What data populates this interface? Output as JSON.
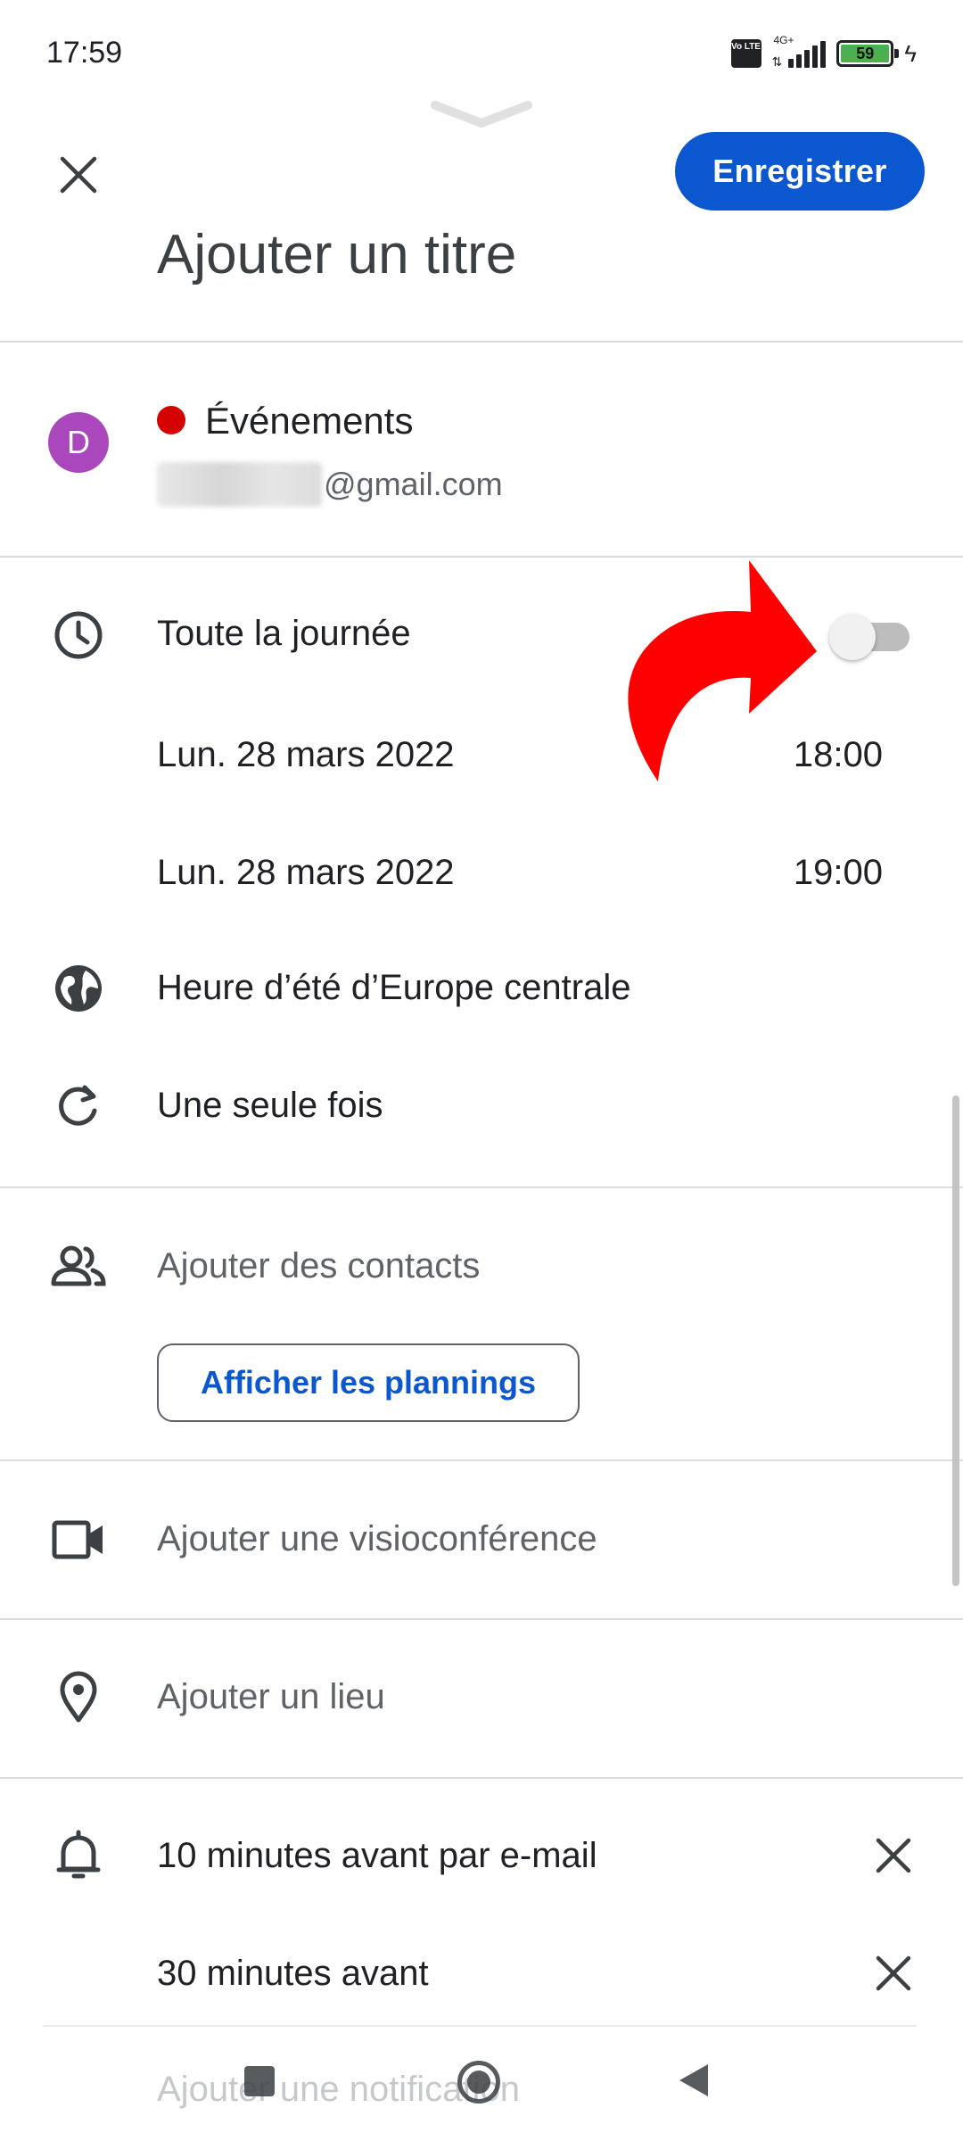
{
  "status_bar": {
    "time": "17:59",
    "volte": "Vo LTE",
    "network": "4G+",
    "battery_level": "59",
    "charging_icon": "bolt-icon"
  },
  "header": {
    "close_icon": "close-icon",
    "save_label": "Enregistrer",
    "title_placeholder": "Ajouter un titre"
  },
  "account": {
    "avatar_letter": "D",
    "calendar_name": "Événements",
    "calendar_color": "#d50000",
    "email_suffix": "@gmail.com"
  },
  "datetime": {
    "all_day_label": "Toute la journée",
    "all_day_on": false,
    "start_date": "Lun. 28 mars 2022",
    "start_time": "18:00",
    "end_date": "Lun. 28 mars 2022",
    "end_time": "19:00",
    "timezone": "Heure d’été d’Europe centrale",
    "recurrence": "Une seule fois"
  },
  "guests": {
    "add_contacts": "Ajouter des contacts",
    "view_schedules": "Afficher les plannings"
  },
  "conference": {
    "label": "Ajouter une visioconférence"
  },
  "location": {
    "label": "Ajouter un lieu"
  },
  "notifications": {
    "items": [
      "10 minutes avant par e-mail",
      "30 minutes avant"
    ],
    "add_label": "Ajouter une notification"
  },
  "colors": {
    "accent": "#0b57d0",
    "avatar": "#ab47bc",
    "arrow": "#ff0000"
  }
}
